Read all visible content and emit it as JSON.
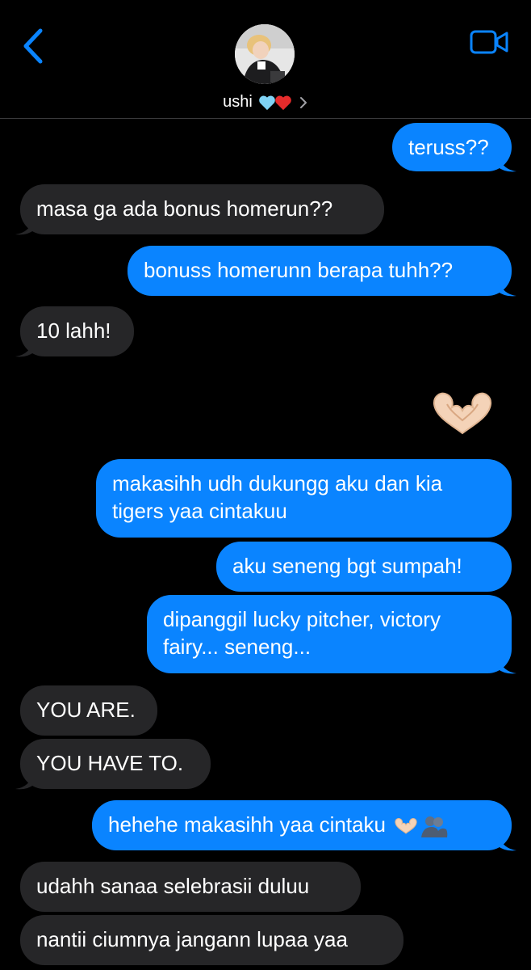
{
  "header": {
    "contact_name": "ushi",
    "contact_emojis": [
      "light-blue-heart",
      "red-heart"
    ],
    "back_icon": "chevron-left-icon",
    "video_icon": "video-camera-icon",
    "accent_color": "#0a84ff"
  },
  "messages": [
    {
      "side": "sent",
      "text": "teruss??"
    },
    {
      "side": "recv",
      "text": "masa ga ada bonus homerun??"
    },
    {
      "side": "sent",
      "text": "bonuss homerunn berapa tuhh??"
    },
    {
      "side": "recv",
      "text": "10 lahh!"
    },
    {
      "side": "sent",
      "emoji": "heart-hands"
    },
    {
      "side": "sent",
      "text": "makasihh udh dukungg aku dan kia tigers yaa cintakuu"
    },
    {
      "side": "sent",
      "text": "aku seneng bgt sumpah!"
    },
    {
      "side": "sent",
      "text": "dipanggil lucky pitcher, victory fairy... seneng..."
    },
    {
      "side": "recv",
      "text": "YOU ARE."
    },
    {
      "side": "recv",
      "text": "YOU HAVE TO."
    },
    {
      "side": "sent",
      "text": "hehehe makasihh yaa cintaku",
      "trailing_emojis": [
        "heart-hands",
        "people-hugging"
      ]
    },
    {
      "side": "recv",
      "text": "udahh sanaa selebrasii duluu"
    },
    {
      "side": "recv",
      "text": "nantii ciumnya jangann lupaa yaa"
    }
  ]
}
